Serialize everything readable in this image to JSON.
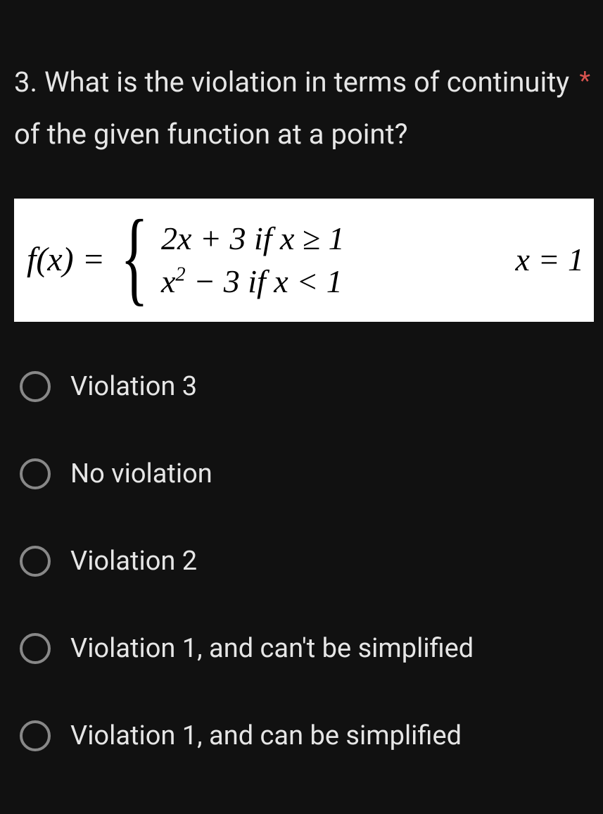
{
  "question": {
    "number_and_text": "3. What is the violation in terms of continuity of the given function at a point?",
    "required_marker": "*"
  },
  "equation": {
    "lhs": "f(x) =",
    "case1": "2x + 3 if x ≥ 1",
    "case2_pre": "x",
    "case2_exp": "2",
    "case2_post": " − 3  if x < 1",
    "side": "x = 1"
  },
  "options": [
    {
      "label": "Violation 3"
    },
    {
      "label": "No violation"
    },
    {
      "label": "Violation 2"
    },
    {
      "label": "Violation 1, and can't be simplified"
    },
    {
      "label": "Violation 1, and can be simplified"
    }
  ]
}
